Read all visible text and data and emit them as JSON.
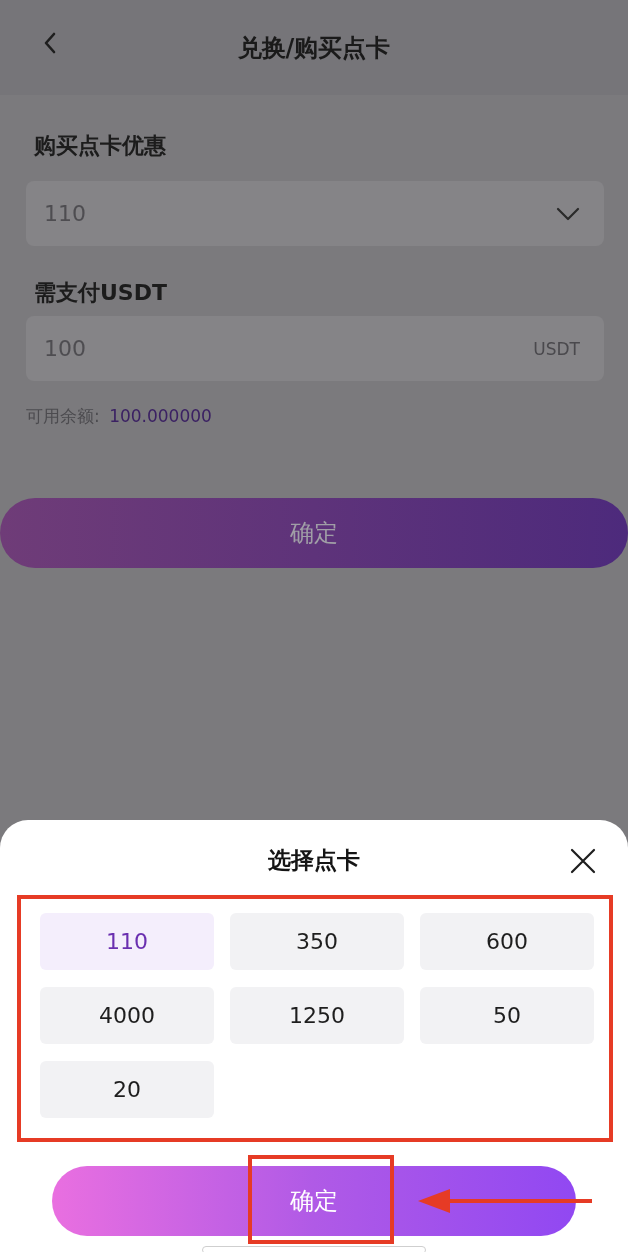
{
  "header": {
    "title": "兑换/购买点卡"
  },
  "form": {
    "card_label": "购买点卡优惠",
    "card_value": "110",
    "pay_label": "需支付USDT",
    "pay_value": "100",
    "pay_unit": "USDT",
    "balance_label": "可用余额:",
    "balance_value": "100.000000",
    "confirm": "确定"
  },
  "sheet": {
    "title": "选择点卡",
    "options": [
      {
        "label": "110",
        "selected": true
      },
      {
        "label": "350",
        "selected": false
      },
      {
        "label": "600",
        "selected": false
      },
      {
        "label": "4000",
        "selected": false
      },
      {
        "label": "1250",
        "selected": false
      },
      {
        "label": "50",
        "selected": false
      },
      {
        "label": "20",
        "selected": false
      }
    ],
    "confirm": "确定"
  }
}
